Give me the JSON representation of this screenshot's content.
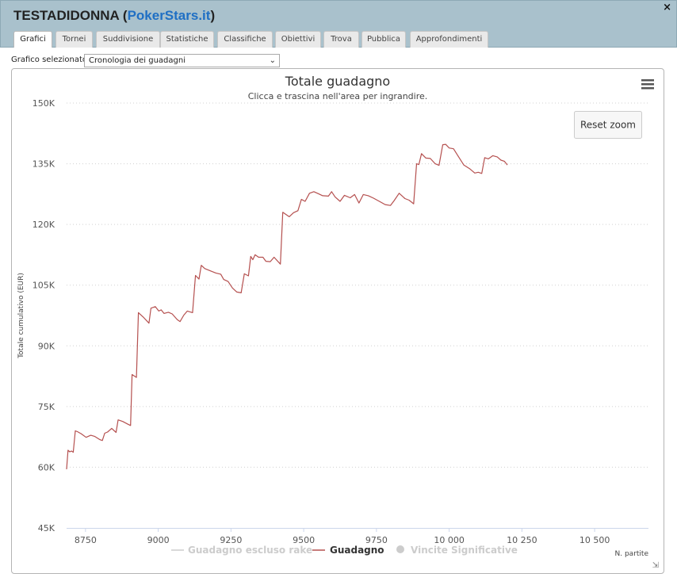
{
  "window": {
    "player_name": "TESTADIDONNA",
    "site_name": "PokerStars.it",
    "paren_open": " (",
    "paren_close": ")",
    "close_glyph": "×"
  },
  "tabs": [
    {
      "label": "Grafici",
      "active": true
    },
    {
      "label": "Tornei",
      "active": false
    },
    {
      "label": "Suddivisione",
      "active": false
    },
    {
      "label": "Statistiche",
      "active": false
    },
    {
      "label": "Classifiche",
      "active": false
    },
    {
      "label": "Obiettivi",
      "active": false
    },
    {
      "label": "Trova",
      "active": false
    },
    {
      "label": "Pubblica",
      "active": false
    },
    {
      "label": "Approfondimenti",
      "active": false
    }
  ],
  "selector": {
    "label": "Grafico selezionato",
    "value": "Cronologia dei guadagni"
  },
  "chart_data": {
    "type": "line",
    "title": "Totale guadagno",
    "subtitle": "Clicca e trascina nell'area per ingrandire.",
    "ylabel": "Totale cumulativo (EUR)",
    "xlabel": "N. partite",
    "reset_zoom_label": "Reset zoom",
    "menu_icon": "hamburger-menu-icon",
    "ylim": [
      45000,
      150000
    ],
    "xlim": [
      8685,
      10685
    ],
    "y_ticks": [
      45000,
      60000,
      75000,
      90000,
      105000,
      120000,
      135000,
      150000
    ],
    "y_tick_labels": [
      "45K",
      "60K",
      "75K",
      "90K",
      "105K",
      "120K",
      "135K",
      "150K"
    ],
    "x_ticks": [
      8750,
      9000,
      9250,
      9500,
      9750,
      10000,
      10250,
      10500
    ],
    "x_tick_labels": [
      "8750",
      "9000",
      "9250",
      "9500",
      "9750",
      "10 000",
      "10 250",
      "10 500"
    ],
    "grid": "horizontal-dotted",
    "legend_position": "bottom-center",
    "series": [
      {
        "name": "Guadagno escluso rake",
        "color": "#cccccc",
        "visible": false,
        "legend_symbol": "line",
        "points": []
      },
      {
        "name": "Guadagno",
        "color": "#b5504f",
        "visible": true,
        "legend_symbol": "line",
        "points": [
          [
            8685,
            59500
          ],
          [
            8690,
            64200
          ],
          [
            8696,
            63800
          ],
          [
            8702,
            64000
          ],
          [
            8708,
            63700
          ],
          [
            8715,
            69000
          ],
          [
            8722,
            68800
          ],
          [
            8735,
            68300
          ],
          [
            8752,
            67400
          ],
          [
            8768,
            67900
          ],
          [
            8782,
            67600
          ],
          [
            8800,
            66800
          ],
          [
            8808,
            66600
          ],
          [
            8816,
            68400
          ],
          [
            8826,
            68700
          ],
          [
            8840,
            69600
          ],
          [
            8855,
            68600
          ],
          [
            8862,
            71700
          ],
          [
            8878,
            71300
          ],
          [
            8894,
            70700
          ],
          [
            8905,
            70300
          ],
          [
            8910,
            82900
          ],
          [
            8925,
            82200
          ],
          [
            8932,
            98200
          ],
          [
            8950,
            97000
          ],
          [
            8968,
            95600
          ],
          [
            8975,
            99300
          ],
          [
            8990,
            99700
          ],
          [
            9002,
            98600
          ],
          [
            9010,
            98900
          ],
          [
            9020,
            98000
          ],
          [
            9035,
            98300
          ],
          [
            9048,
            97900
          ],
          [
            9065,
            96500
          ],
          [
            9075,
            96000
          ],
          [
            9088,
            97600
          ],
          [
            9100,
            98600
          ],
          [
            9118,
            98200
          ],
          [
            9128,
            107400
          ],
          [
            9140,
            106500
          ],
          [
            9148,
            109900
          ],
          [
            9160,
            109100
          ],
          [
            9180,
            108500
          ],
          [
            9198,
            108000
          ],
          [
            9215,
            107700
          ],
          [
            9225,
            106400
          ],
          [
            9240,
            105900
          ],
          [
            9255,
            104300
          ],
          [
            9270,
            103300
          ],
          [
            9285,
            103100
          ],
          [
            9296,
            107800
          ],
          [
            9310,
            107300
          ],
          [
            9318,
            112100
          ],
          [
            9325,
            111300
          ],
          [
            9333,
            112500
          ],
          [
            9345,
            111900
          ],
          [
            9360,
            111900
          ],
          [
            9370,
            110900
          ],
          [
            9385,
            110800
          ],
          [
            9398,
            111900
          ],
          [
            9420,
            110200
          ],
          [
            9428,
            123000
          ],
          [
            9450,
            121900
          ],
          [
            9465,
            122900
          ],
          [
            9480,
            123400
          ],
          [
            9492,
            126200
          ],
          [
            9505,
            125700
          ],
          [
            9520,
            127700
          ],
          [
            9535,
            128100
          ],
          [
            9550,
            127600
          ],
          [
            9565,
            127100
          ],
          [
            9585,
            127000
          ],
          [
            9596,
            128100
          ],
          [
            9608,
            126800
          ],
          [
            9625,
            125700
          ],
          [
            9640,
            127200
          ],
          [
            9660,
            126600
          ],
          [
            9675,
            127400
          ],
          [
            9690,
            125300
          ],
          [
            9705,
            127400
          ],
          [
            9722,
            127100
          ],
          [
            9740,
            126500
          ],
          [
            9760,
            125700
          ],
          [
            9780,
            124900
          ],
          [
            9798,
            124700
          ],
          [
            9810,
            125800
          ],
          [
            9828,
            127700
          ],
          [
            9848,
            126400
          ],
          [
            9862,
            126000
          ],
          [
            9878,
            125100
          ],
          [
            9888,
            135000
          ],
          [
            9896,
            134800
          ],
          [
            9905,
            137500
          ],
          [
            9920,
            136400
          ],
          [
            9935,
            136300
          ],
          [
            9952,
            135000
          ],
          [
            9965,
            134600
          ],
          [
            9978,
            139700
          ],
          [
            9988,
            139800
          ],
          [
            10000,
            138900
          ],
          [
            10015,
            138700
          ],
          [
            10030,
            137000
          ],
          [
            10050,
            134700
          ],
          [
            10070,
            133800
          ],
          [
            10088,
            132700
          ],
          [
            10100,
            132900
          ],
          [
            10112,
            132600
          ],
          [
            10122,
            136500
          ],
          [
            10135,
            136200
          ],
          [
            10150,
            137000
          ],
          [
            10165,
            136700
          ],
          [
            10178,
            135900
          ],
          [
            10190,
            135600
          ],
          [
            10200,
            134700
          ]
        ]
      },
      {
        "name": "Vincite Significative",
        "color": "#cccccc",
        "visible": false,
        "legend_symbol": "circle",
        "points": []
      }
    ]
  }
}
